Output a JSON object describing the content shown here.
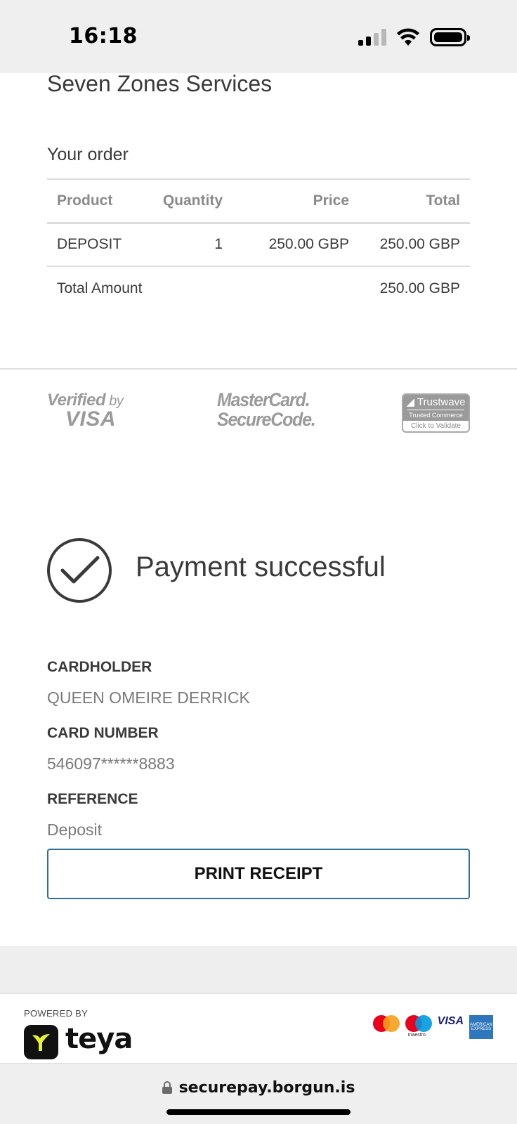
{
  "status_bar": {
    "time": "16:18"
  },
  "merchant_name": "Seven Zones Services",
  "order": {
    "title": "Your order",
    "columns": [
      "Product",
      "Quantity",
      "Price",
      "Total"
    ],
    "items": [
      {
        "product": "DEPOSIT",
        "quantity": "1",
        "price": "250.00 GBP",
        "total": "250.00 GBP"
      }
    ],
    "total_label": "Total Amount",
    "total_value": "250.00 GBP"
  },
  "badges": {
    "vbv_line1": "Verified",
    "vbv_by": "by",
    "vbv_line2": "VISA",
    "mc_line1": "MasterCard.",
    "mc_line2": "SecureCode.",
    "tw_name": "Trustwave",
    "tw_sub": "Trusted Commerce",
    "tw_validate": "Click to Validate"
  },
  "payment": {
    "status": "Payment successful",
    "cardholder_label": "CARDHOLDER",
    "cardholder_value": "QUEEN OMEIRE DERRICK",
    "card_number_label": "CARD NUMBER",
    "card_number_value": "546097******8883",
    "reference_label": "REFERENCE",
    "reference_value": "Deposit",
    "print_button": "PRINT RECEIPT"
  },
  "footer": {
    "powered_by": "POWERED BY",
    "brand": "teya",
    "card_logos": [
      "mastercard-icon",
      "maestro-icon",
      "visa-icon",
      "amex-icon"
    ],
    "maestro_text": "maestro",
    "visa_text": "VISA",
    "amex_text": "AMERICAN EXPRESS"
  },
  "url_bar": {
    "url": "securepay.borgun.is"
  },
  "colors": {
    "button_border": "#2e6f92",
    "text_primary": "#3a3a3a",
    "text_muted": "#8a8a8a"
  }
}
